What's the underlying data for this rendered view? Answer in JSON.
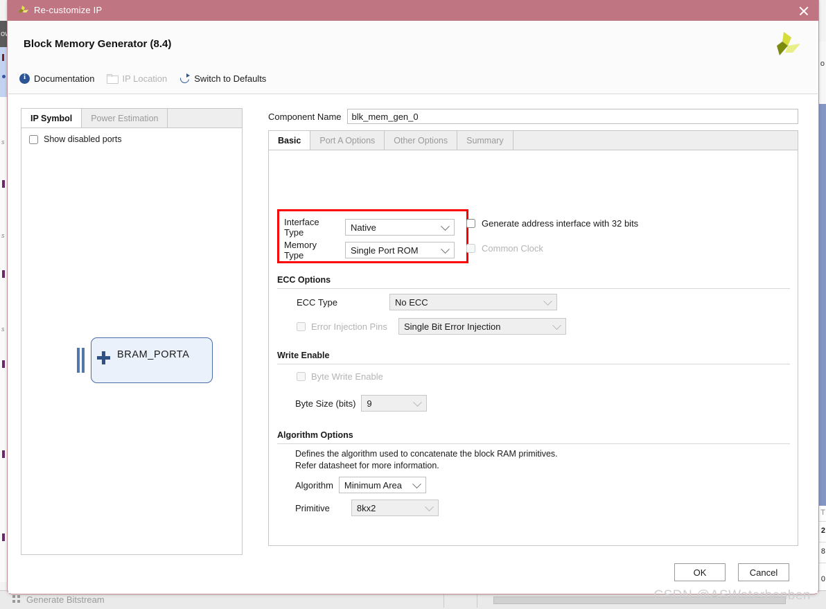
{
  "titlebar": {
    "title": "Re-customize IP",
    "logo_icon": "xilinx-logo-icon",
    "close_icon": "close-icon",
    "bg_color": "#c07582"
  },
  "header": {
    "title": "Block Memory Generator (8.4)",
    "logo_icon": "xilinx-propeller-logo-icon",
    "links": [
      {
        "label": "Documentation",
        "icon": "info-icon",
        "enabled": true
      },
      {
        "label": "IP Location",
        "icon": "folder-icon",
        "enabled": false
      },
      {
        "label": "Switch to Defaults",
        "icon": "refresh-icon",
        "enabled": true
      }
    ]
  },
  "left_panel": {
    "tabs": [
      {
        "label": "IP Symbol",
        "active": true
      },
      {
        "label": "Power Estimation",
        "active": false
      }
    ],
    "show_disabled_ports": {
      "label": "Show disabled ports",
      "checked": false
    },
    "symbol": {
      "block_label": "BRAM_PORTA",
      "expand_icon": "plus-icon",
      "port_icon": "bus-port-icon",
      "fill_color": "#eaf1fb",
      "border_color": "#4a6ea8"
    }
  },
  "right_panel": {
    "component_name": {
      "label": "Component Name",
      "value": "blk_mem_gen_0",
      "placeholder": "blk_mem_gen_0"
    },
    "tabs": [
      {
        "label": "Basic",
        "active": true
      },
      {
        "label": "Port A Options",
        "active": false
      },
      {
        "label": "Other Options",
        "active": false
      },
      {
        "label": "Summary",
        "active": false
      }
    ],
    "basic": {
      "highlight_color": "#fb0000",
      "interface_type": {
        "label": "Interface Type",
        "value": "Native",
        "enabled": true,
        "chevron_icon": "chevron-down-icon"
      },
      "memory_type": {
        "label": "Memory Type",
        "value": "Single Port ROM",
        "enabled": true,
        "chevron_icon": "chevron-down-icon"
      },
      "generate_address_interface": {
        "label": "Generate address interface with 32 bits",
        "checked": false,
        "enabled": true
      },
      "common_clock": {
        "label": "Common Clock",
        "checked": false,
        "enabled": false
      },
      "ecc_options": {
        "title": "ECC Options",
        "ecc_type": {
          "label": "ECC Type",
          "value": "No ECC",
          "enabled": false,
          "chevron_icon": "chevron-down-icon"
        },
        "error_injection_pins": {
          "label": "Error Injection Pins",
          "checked": false,
          "enabled": false,
          "value": "Single Bit Error Injection",
          "chevron_icon": "chevron-down-icon"
        }
      },
      "write_enable": {
        "title": "Write Enable",
        "byte_write_enable": {
          "label": "Byte Write Enable",
          "checked": false,
          "enabled": false
        },
        "byte_size": {
          "label": "Byte Size (bits)",
          "value": "9",
          "enabled": false,
          "chevron_icon": "chevron-down-icon"
        }
      },
      "algorithm_options": {
        "title": "Algorithm Options",
        "help_line_1": "Defines the algorithm used to concatenate the block RAM primitives.",
        "help_line_2": "Refer datasheet for more information.",
        "algorithm": {
          "label": "Algorithm",
          "value": "Minimum Area",
          "enabled": true,
          "chevron_icon": "chevron-down-icon"
        },
        "primitive": {
          "label": "Primitive",
          "value": "8kx2",
          "enabled": false,
          "chevron_icon": "chevron-down-icon"
        }
      }
    }
  },
  "footer": {
    "ok_label": "OK",
    "cancel_label": "Cancel"
  },
  "watermark": "CSDN @ASWaterbenben",
  "background": {
    "left_tab_text": "ow",
    "bottom_task_label": "Generate Bitstream",
    "right_edge_chars": [
      "T",
      "2",
      "8",
      "0"
    ],
    "right_top_char": "o"
  }
}
